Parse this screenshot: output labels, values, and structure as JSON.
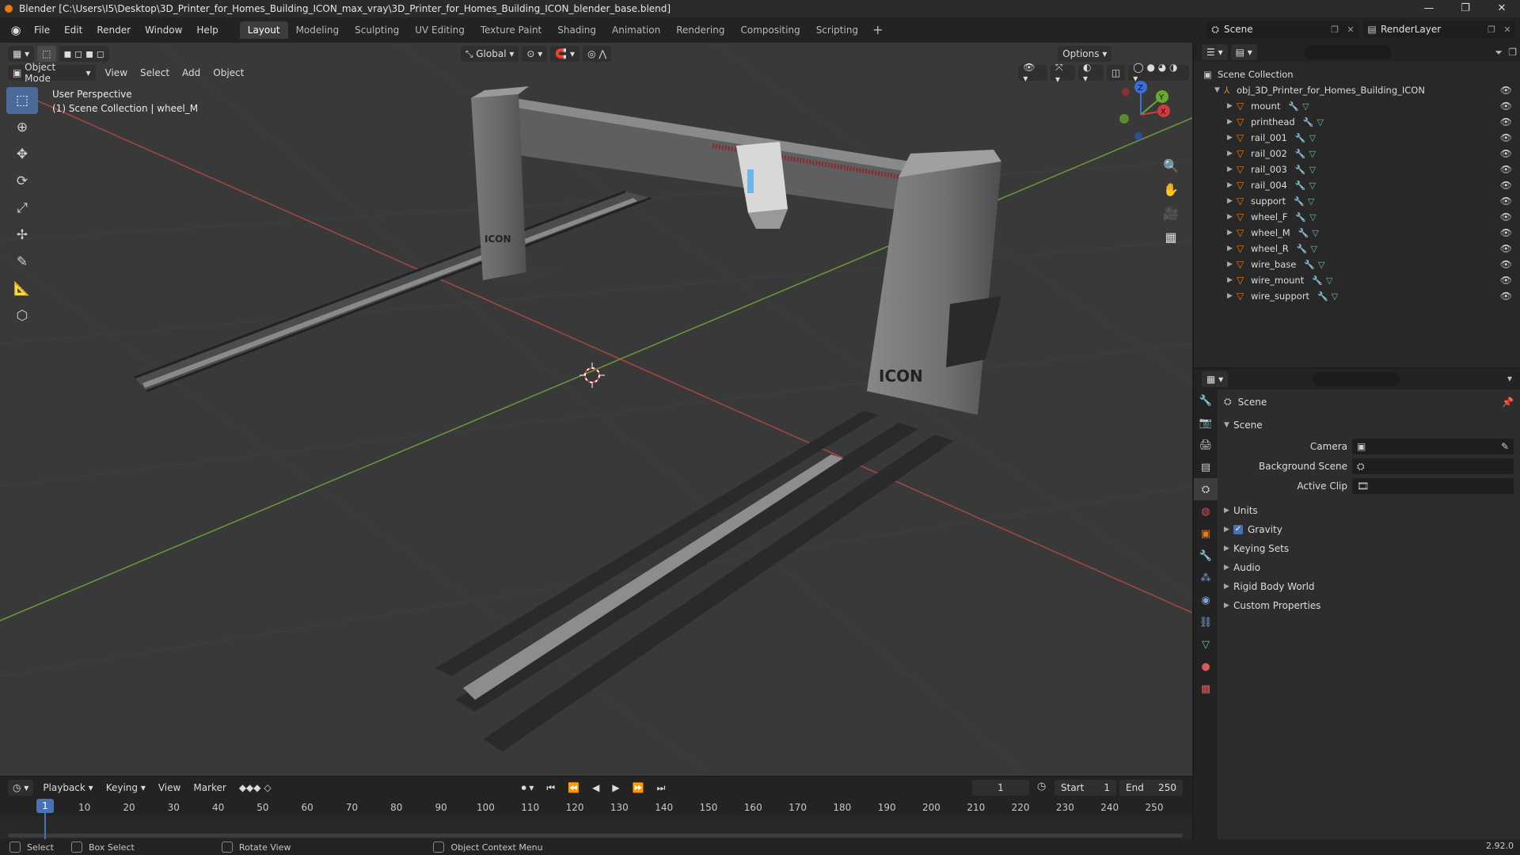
{
  "window": {
    "title": "Blender [C:\\Users\\I5\\Desktop\\3D_Printer_for_Homes_Building_ICON_max_vray\\3D_Printer_for_Homes_Building_ICON_blender_base.blend]",
    "controls": [
      "—",
      "❐",
      "✕"
    ]
  },
  "menu": {
    "items": [
      "File",
      "Edit",
      "Render",
      "Window",
      "Help"
    ],
    "workspaces": [
      "Layout",
      "Modeling",
      "Sculpting",
      "UV Editing",
      "Texture Paint",
      "Shading",
      "Animation",
      "Rendering",
      "Compositing",
      "Scripting"
    ],
    "active_workspace": "Layout",
    "scene": "Scene",
    "render_layer": "RenderLayer"
  },
  "viewport": {
    "mode": "Object Mode",
    "header_menus": [
      "View",
      "Select",
      "Add",
      "Object"
    ],
    "transform_orientation": "Global",
    "options": "Options",
    "info_line1": "User Perspective",
    "info_line2": "(1) Scene Collection | wheel_M",
    "logo_text": "ICON",
    "gizmo_axes": [
      "Z",
      "Y",
      "X"
    ]
  },
  "colors": {
    "accent": "#4772b3",
    "object_orange": "#e87d0d",
    "x_axis": "#d23c3c",
    "y_axis": "#6aa832"
  },
  "timeline": {
    "menus": [
      "Playback",
      "Keying",
      "View",
      "Marker"
    ],
    "current_frame": "1",
    "start_label": "Start",
    "start": "1",
    "end_label": "End",
    "end": "250",
    "ticks": [
      "1",
      "10",
      "20",
      "30",
      "40",
      "50",
      "60",
      "70",
      "80",
      "90",
      "100",
      "110",
      "120",
      "130",
      "140",
      "150",
      "160",
      "170",
      "180",
      "190",
      "200",
      "210",
      "220",
      "230",
      "240",
      "250"
    ]
  },
  "outliner": {
    "root": "Scene Collection",
    "parent": "obj_3D_Printer_for_Homes_Building_ICON",
    "children": [
      "mount",
      "printhead",
      "rail_001",
      "rail_002",
      "rail_003",
      "rail_004",
      "support",
      "wheel_F",
      "wheel_M",
      "wheel_R",
      "wire_base",
      "wire_mount",
      "wire_support"
    ],
    "selected": "wheel_M"
  },
  "properties": {
    "context": "Scene",
    "panel": "Scene",
    "fields": [
      {
        "label": "Camera",
        "value": ""
      },
      {
        "label": "Background Scene",
        "value": ""
      },
      {
        "label": "Active Clip",
        "value": ""
      }
    ],
    "sections": [
      "Units",
      "Gravity",
      "Keying Sets",
      "Audio",
      "Rigid Body World",
      "Custom Properties"
    ],
    "gravity_checked": true
  },
  "status": {
    "items": [
      "Select",
      "Box Select",
      "Rotate View",
      "Object Context Menu"
    ],
    "version": "2.92.0"
  }
}
